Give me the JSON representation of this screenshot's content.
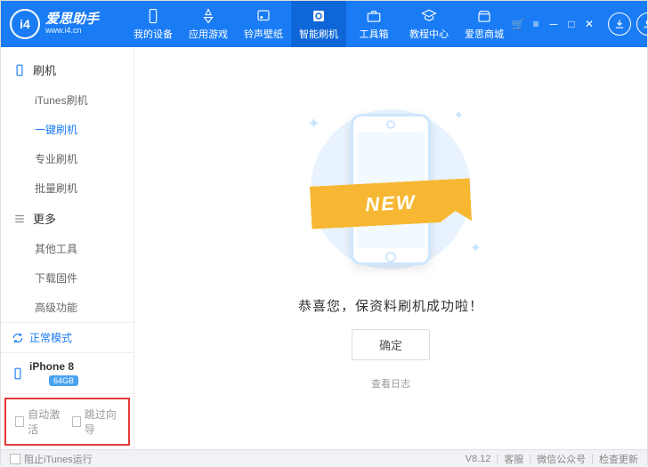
{
  "app": {
    "name": "爱思助手",
    "url": "www.i4.cn",
    "logo_initials": "i4"
  },
  "nav": {
    "items": [
      {
        "id": "device",
        "label": "我的设备"
      },
      {
        "id": "apps",
        "label": "应用游戏"
      },
      {
        "id": "ring",
        "label": "铃声壁纸"
      },
      {
        "id": "flash",
        "label": "智能刷机",
        "active": true
      },
      {
        "id": "tools",
        "label": "工具箱"
      },
      {
        "id": "tutorial",
        "label": "教程中心"
      },
      {
        "id": "mall",
        "label": "爱思商城"
      }
    ]
  },
  "sidebar": {
    "group1": {
      "title": "刷机",
      "items": [
        {
          "id": "itunes",
          "label": "iTunes刷机"
        },
        {
          "id": "onekey",
          "label": "一键刷机",
          "active": true
        },
        {
          "id": "pro",
          "label": "专业刷机"
        },
        {
          "id": "batch",
          "label": "批量刷机"
        }
      ]
    },
    "group2": {
      "title": "更多",
      "items": [
        {
          "id": "other",
          "label": "其他工具"
        },
        {
          "id": "fw",
          "label": "下载固件"
        },
        {
          "id": "adv",
          "label": "高级功能"
        }
      ]
    },
    "status": "正常模式",
    "device": {
      "name": "iPhone 8",
      "storage": "64GB"
    },
    "auto_activate": "自动激活",
    "skip_guide": "跳过向导"
  },
  "main": {
    "badge": "NEW",
    "message": "恭喜您，保资料刷机成功啦！",
    "ok": "确定",
    "view_log": "查看日志"
  },
  "footer": {
    "block_itunes": "阻止iTunes运行",
    "version": "V8.12",
    "support": "客服",
    "wechat": "微信公众号",
    "update": "检查更新"
  }
}
